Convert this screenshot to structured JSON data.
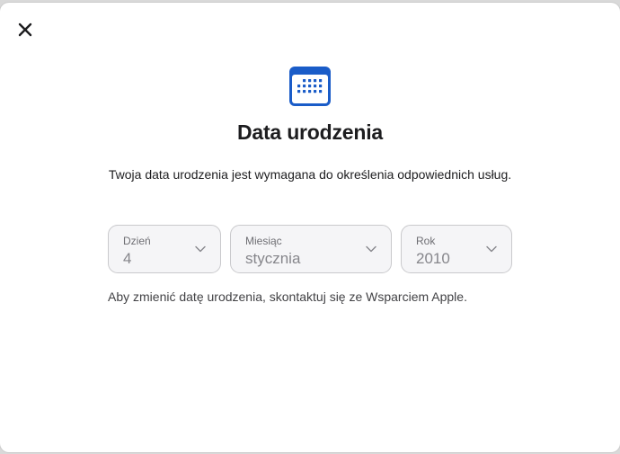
{
  "dialog": {
    "title": "Data urodzenia",
    "subtitle": "Twoja data urodzenia jest wymagana do określenia odpowiednich usług.",
    "note": "Aby zmienić datę urodzenia, skontaktuj się ze Wsparciem Apple.",
    "close_icon": "close-icon",
    "header_icon": "calendar-icon",
    "accent_color": "#1a5cc8"
  },
  "fields": {
    "day": {
      "label": "Dzień",
      "value": "4"
    },
    "month": {
      "label": "Miesiąc",
      "value": "stycznia"
    },
    "year": {
      "label": "Rok",
      "value": "2010"
    }
  }
}
